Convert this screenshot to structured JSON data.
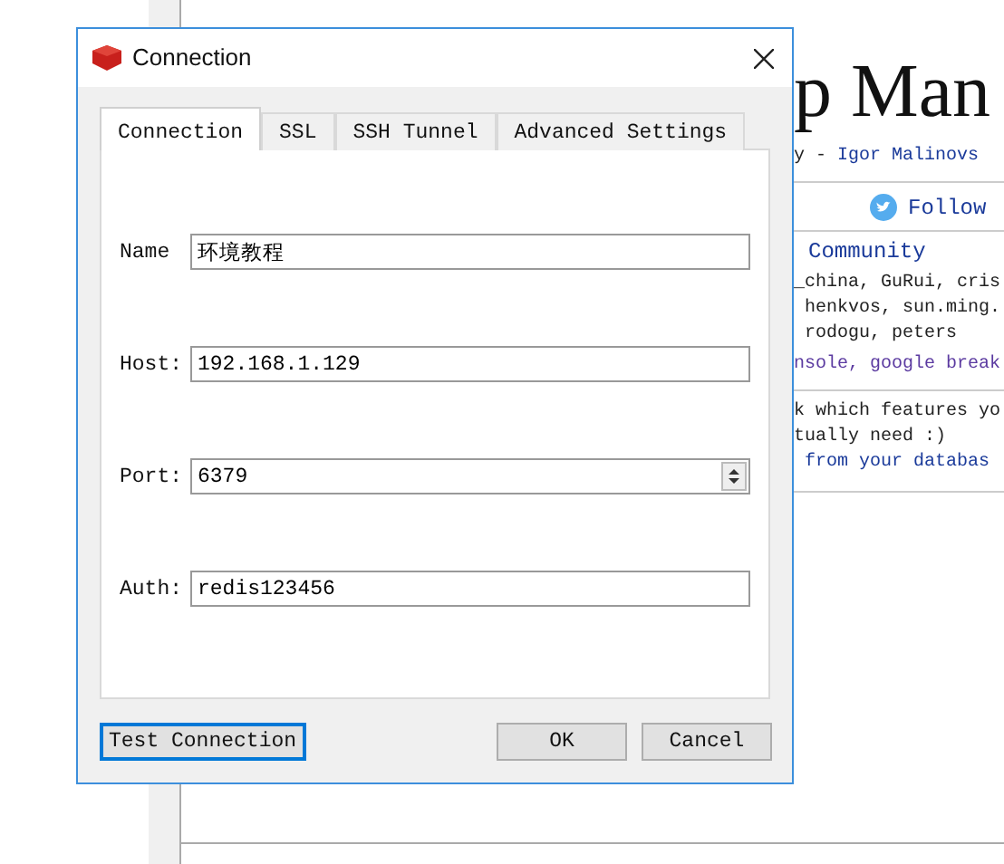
{
  "background": {
    "heading": "p Man",
    "byline": {
      "prefix": "y - ",
      "author": "Igor Malinovs"
    },
    "follow": "Follow",
    "community": {
      "title": "Community",
      "names": [
        "_china, GuRui, cris",
        " henkvos, sun.ming.",
        " rodogu, peters"
      ],
      "links": "nsole, google break"
    },
    "note": {
      "lines": [
        "k which features yo",
        "tually need :)"
      ],
      "link": "from your databas"
    }
  },
  "dialog": {
    "title": "Connection",
    "tabs": [
      {
        "label": "Connection",
        "selected": true
      },
      {
        "label": "SSL",
        "selected": false
      },
      {
        "label": "SSH Tunnel",
        "selected": false
      },
      {
        "label": "Advanced Settings",
        "selected": false
      }
    ],
    "fields": [
      {
        "kind": "text",
        "label": "Name",
        "value": "环境教程"
      },
      {
        "kind": "text",
        "label": "Host:",
        "value": "192.168.1.129"
      },
      {
        "kind": "spin",
        "label": "Port:",
        "value": "6379"
      },
      {
        "kind": "text",
        "label": "Auth:",
        "value": "redis123456"
      }
    ],
    "buttons": [
      {
        "label": "Test Connection",
        "focused": true
      },
      {
        "label": "OK",
        "focused": false
      },
      {
        "label": "Cancel",
        "focused": false
      }
    ]
  }
}
